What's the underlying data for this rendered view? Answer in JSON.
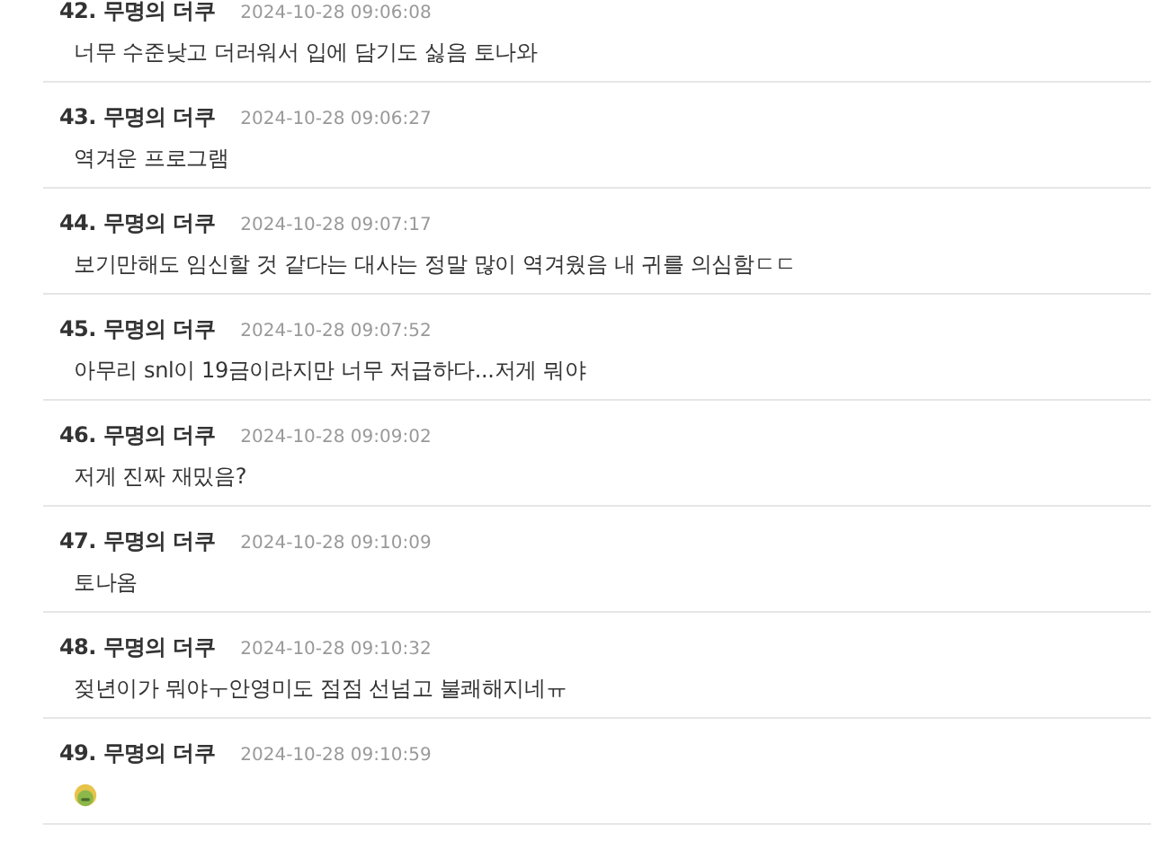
{
  "comments": [
    {
      "number": "42.",
      "author": "무명의 더쿠",
      "time": "2024-10-28 09:06:08",
      "kind": "text",
      "body": "너무 수준낮고 더러워서 입에 담기도 싫음 토나와"
    },
    {
      "number": "43.",
      "author": "무명의 더쿠",
      "time": "2024-10-28 09:06:27",
      "kind": "text",
      "body": "역겨운 프로그램"
    },
    {
      "number": "44.",
      "author": "무명의 더쿠",
      "time": "2024-10-28 09:07:17",
      "kind": "text",
      "body": "보기만해도 임신할 것 같다는 대사는 정말 많이 역겨웠음 내 귀를 의심함ㄷㄷ"
    },
    {
      "number": "45.",
      "author": "무명의 더쿠",
      "time": "2024-10-28 09:07:52",
      "kind": "text",
      "body": "아무리 snl이 19금이라지만 너무 저급하다...저게 뭐야"
    },
    {
      "number": "46.",
      "author": "무명의 더쿠",
      "time": "2024-10-28 09:09:02",
      "kind": "text",
      "body": "저게 진짜 재밌음?"
    },
    {
      "number": "47.",
      "author": "무명의 더쿠",
      "time": "2024-10-28 09:10:09",
      "kind": "text",
      "body": "토나옴"
    },
    {
      "number": "48.",
      "author": "무명의 더쿠",
      "time": "2024-10-28 09:10:32",
      "kind": "text",
      "body": "젖년이가 뭐야ㅜ안영미도 점점 선넘고 불쾌해지네ㅠ"
    },
    {
      "number": "49.",
      "author": "무명의 더쿠",
      "time": "2024-10-28 09:10:59",
      "kind": "emoji"
    }
  ]
}
